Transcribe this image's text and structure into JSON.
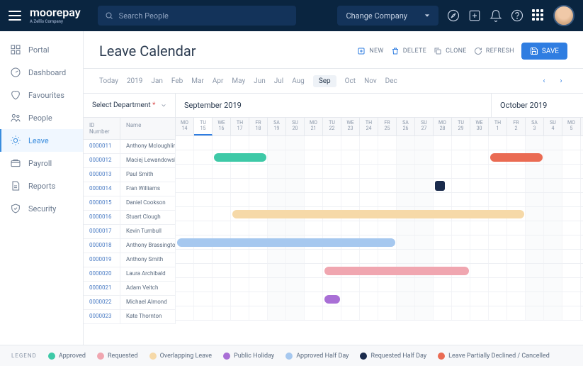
{
  "header": {
    "logo": "moorepay",
    "logo_sub": "A Zellis Company",
    "search_placeholder": "Search People",
    "company_select": "Change Company"
  },
  "sidebar": {
    "items": [
      {
        "label": "Portal"
      },
      {
        "label": "Dashboard"
      },
      {
        "label": "Favourites"
      },
      {
        "label": "People"
      },
      {
        "label": "Leave"
      },
      {
        "label": "Payroll"
      },
      {
        "label": "Reports"
      },
      {
        "label": "Security"
      }
    ]
  },
  "page": {
    "title": "Leave Calendar",
    "actions": {
      "new": "NEW",
      "delete": "DELETE",
      "clone": "CLONE",
      "refresh": "REFRESH",
      "save": "SAVE"
    }
  },
  "months": {
    "today": "Today",
    "year": "2019",
    "list": [
      "Jan",
      "Feb",
      "Mar",
      "Apr",
      "May",
      "Jun",
      "Jul",
      "Aug",
      "Sep",
      "Oct",
      "Nov",
      "Dec"
    ],
    "active": "Sep"
  },
  "filters": {
    "dept": "Select Department",
    "month1": "September 2019",
    "month2": "October 2019"
  },
  "columns": {
    "id": "ID Number",
    "name": "Name"
  },
  "days": [
    {
      "dow": "MO",
      "n": "14"
    },
    {
      "dow": "TU",
      "n": "15",
      "today": true
    },
    {
      "dow": "WE",
      "n": "16"
    },
    {
      "dow": "TH",
      "n": "17"
    },
    {
      "dow": "FR",
      "n": "18"
    },
    {
      "dow": "SA",
      "n": "19",
      "we": true
    },
    {
      "dow": "SU",
      "n": "20",
      "we": true
    },
    {
      "dow": "MO",
      "n": "21"
    },
    {
      "dow": "TU",
      "n": "22"
    },
    {
      "dow": "WE",
      "n": "23"
    },
    {
      "dow": "TH",
      "n": "24"
    },
    {
      "dow": "FR",
      "n": "25"
    },
    {
      "dow": "SA",
      "n": "26",
      "we": true
    },
    {
      "dow": "SU",
      "n": "27",
      "we": true
    },
    {
      "dow": "MO",
      "n": "28"
    },
    {
      "dow": "TU",
      "n": "29"
    },
    {
      "dow": "WE",
      "n": "30"
    },
    {
      "dow": "TH",
      "n": "1"
    },
    {
      "dow": "FR",
      "n": "2"
    },
    {
      "dow": "SA",
      "n": "3",
      "we": true
    },
    {
      "dow": "SU",
      "n": "4",
      "we": true
    },
    {
      "dow": "MO",
      "n": "5"
    }
  ],
  "people": [
    {
      "id": "0000011",
      "name": "Anthony Mcloughlin"
    },
    {
      "id": "0000012",
      "name": "Maciej Lewandowski"
    },
    {
      "id": "0000013",
      "name": "Paul Smith"
    },
    {
      "id": "0000014",
      "name": "Fran Williams"
    },
    {
      "id": "0000015",
      "name": "Daniel Cookson"
    },
    {
      "id": "0000016",
      "name": "Stuart Clough"
    },
    {
      "id": "0000017",
      "name": "Kevin Turnbull"
    },
    {
      "id": "0000018",
      "name": "Anthony Brassington"
    },
    {
      "id": "0000019",
      "name": "Anthony Smith"
    },
    {
      "id": "0000020",
      "name": "Laura Archibald"
    },
    {
      "id": "0000021",
      "name": "Adam Veitch"
    },
    {
      "id": "0000022",
      "name": "Michael Almond"
    },
    {
      "id": "0000023",
      "name": "Kate Thornton"
    }
  ],
  "bars": [
    {
      "row": 1,
      "start": 2,
      "span": 3,
      "color": "#3ec9a7"
    },
    {
      "row": 1,
      "start": 17,
      "span": 3,
      "color": "#ea6b53"
    },
    {
      "row": 3,
      "start": 14,
      "span": 1,
      "color": "#1a2b4c",
      "half": true
    },
    {
      "row": 5,
      "start": 3,
      "span": 16,
      "color": "#f6d9a8"
    },
    {
      "row": 7,
      "start": 0,
      "span": 12,
      "color": "#a6c8ef"
    },
    {
      "row": 9,
      "start": 8,
      "span": 8,
      "color": "#f0a6b0"
    },
    {
      "row": 11,
      "start": 8,
      "span": 1,
      "color": "#a96fd6"
    }
  ],
  "legend": {
    "title": "LEGEND",
    "items": [
      {
        "label": "Approved",
        "color": "#3ec9a7"
      },
      {
        "label": "Requested",
        "color": "#f0a6b0"
      },
      {
        "label": "Overlapping Leave",
        "color": "#f6d9a8"
      },
      {
        "label": "Public Holiday",
        "color": "#a96fd6"
      },
      {
        "label": "Approved Half Day",
        "color": "#a6c8ef"
      },
      {
        "label": "Requested Half Day",
        "color": "#1a2b4c"
      },
      {
        "label": "Leave Partially Declined / Cancelled",
        "color": "#ea6b53"
      }
    ]
  }
}
